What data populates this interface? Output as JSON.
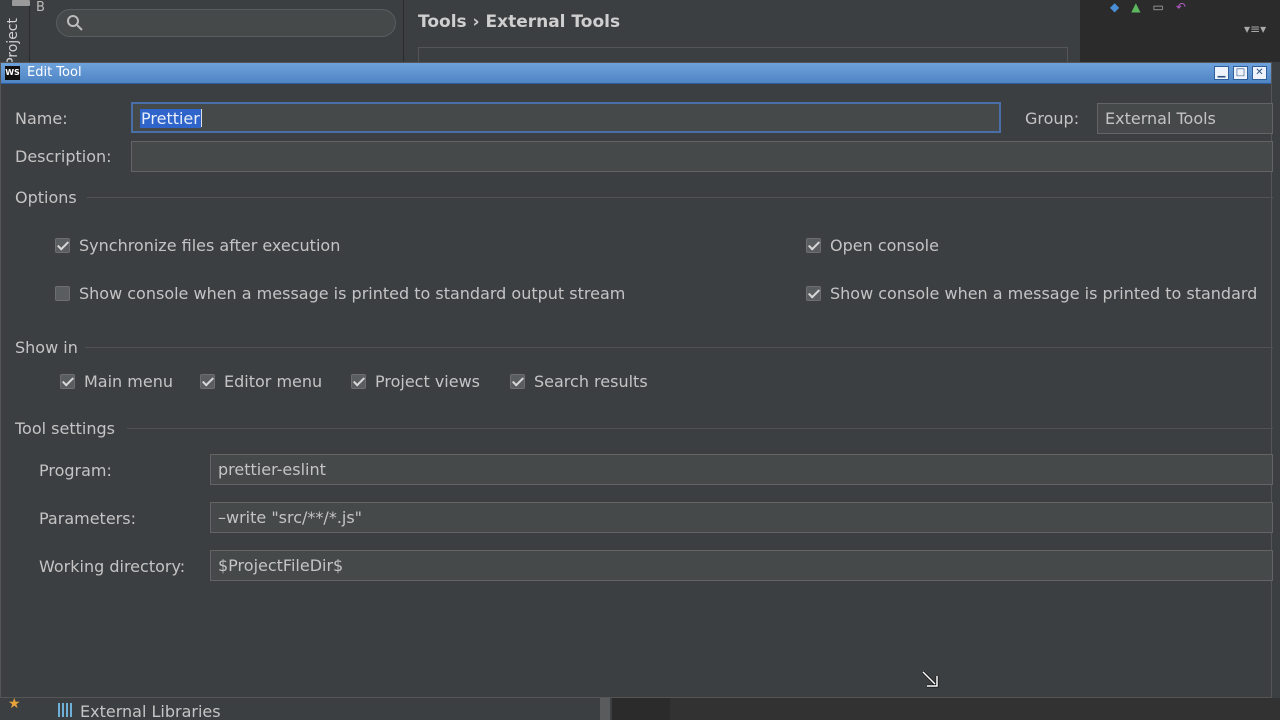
{
  "background": {
    "project_tab": "Project",
    "tree_stub": "B",
    "breadcrumb": "Tools › External Tools",
    "search_icon": "search-icon",
    "menu_glyph": "▾≡▾",
    "bottom_item": "External Libraries"
  },
  "dialog": {
    "title": "Edit Tool",
    "app_icon_text": "WS",
    "window_buttons": [
      "minimize",
      "maximize",
      "close"
    ],
    "name_label": "Name:",
    "name_value": "Prettier",
    "group_label": "Group:",
    "group_value": "External Tools",
    "description_label": "Description:",
    "description_value": "",
    "options": {
      "title": "Options",
      "sync_files": {
        "label": "Synchronize files after execution",
        "checked": true
      },
      "open_console": {
        "label": "Open console",
        "checked": true
      },
      "show_console_stdout": {
        "label": "Show console when a message is printed to standard output stream",
        "checked": false
      },
      "show_console_stderr": {
        "label": "Show console when a message is printed to standard",
        "checked": true
      }
    },
    "show_in": {
      "title": "Show in",
      "items": [
        {
          "label": "Main menu",
          "checked": true
        },
        {
          "label": "Editor menu",
          "checked": true
        },
        {
          "label": "Project views",
          "checked": true
        },
        {
          "label": "Search results",
          "checked": true
        }
      ]
    },
    "tool_settings": {
      "title": "Tool settings",
      "program_label": "Program:",
      "program_value": "prettier-eslint",
      "parameters_label": "Parameters:",
      "parameters_value": "–write  \"src/**/*.js\"",
      "working_dir_label": "Working directory:",
      "working_dir_value": "$ProjectFileDir$"
    }
  },
  "colors": {
    "background": "#3c3f41",
    "titlebar": "#5b8fcf",
    "selection": "#2f65ca",
    "focus_border": "#4a6ea8"
  }
}
